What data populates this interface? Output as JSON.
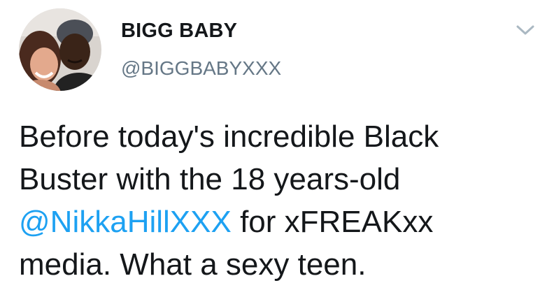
{
  "tweet": {
    "author": {
      "display_name": "BIGG BABY",
      "handle": "@BIGGBABYXXX",
      "avatar_icon": "user-avatar-photo"
    },
    "menu_icon": "chevron-down-icon",
    "text": {
      "line1": "Before today's incredible Black",
      "line2": "Buster with the 18 years-old",
      "line3_mention": "@NikkaHillXXX",
      "line3_rest": " for xFREAKxx",
      "line4": "media. What a sexy teen."
    },
    "colors": {
      "text": "#14171a",
      "secondary": "#657786",
      "link": "#1da1f2",
      "caret": "#aab8c2"
    }
  }
}
